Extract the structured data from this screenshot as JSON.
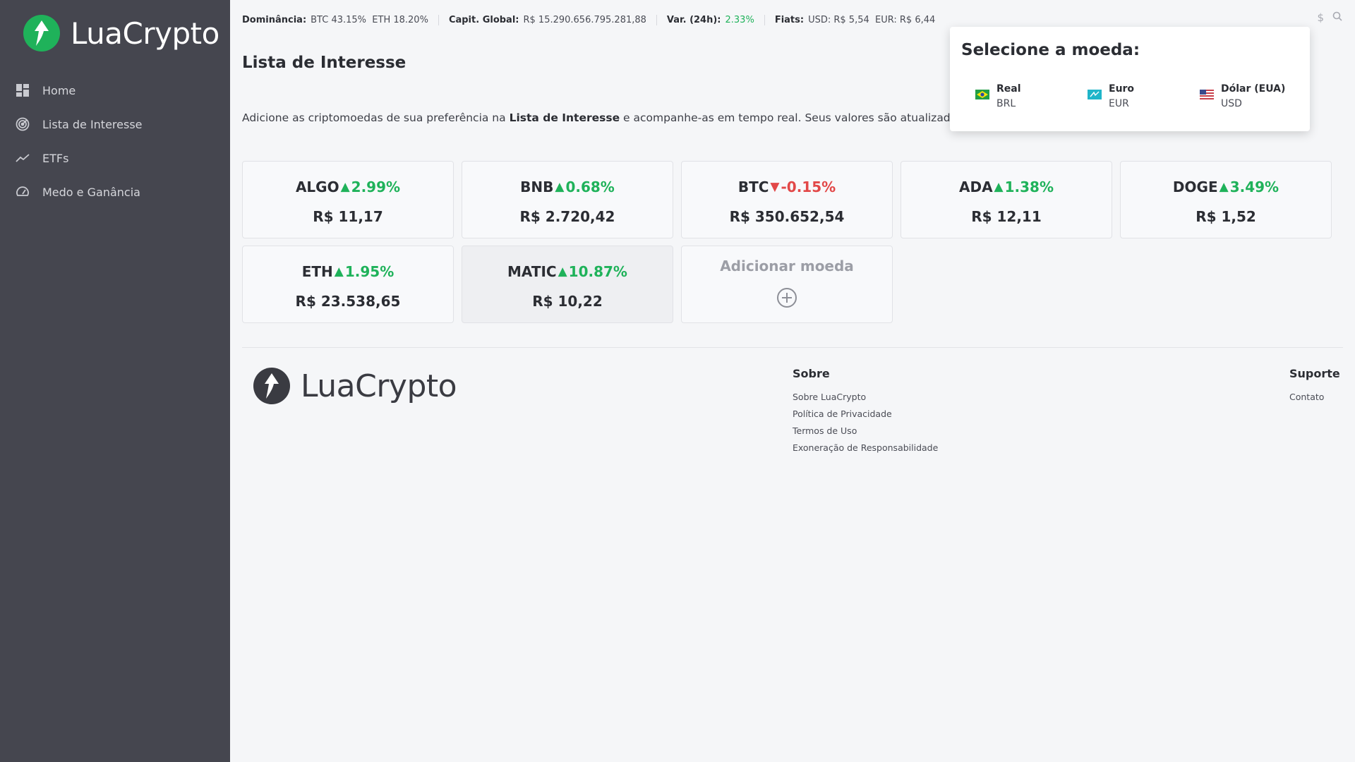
{
  "app": {
    "brand": "LuaCrypto"
  },
  "sidebar": {
    "items": [
      {
        "label": "Home",
        "icon": "dashboard-icon"
      },
      {
        "label": "Lista de Interesse",
        "icon": "radar-icon"
      },
      {
        "label": "ETFs",
        "icon": "trend-line-icon"
      },
      {
        "label": "Medo e Ganância",
        "icon": "gauge-icon"
      }
    ]
  },
  "topbar": {
    "dominance_label": "Dominância:",
    "dominance_btc": "BTC 43.15%",
    "dominance_eth": "ETH 18.20%",
    "cap_label": "Capit. Global:",
    "cap_value": "R$ 15.290.656.795.281,88",
    "var_label": "Var. (24h):",
    "var_value": "2.33%",
    "fiats_label": "Fiats:",
    "fiats_usd": "USD: R$ 5,54",
    "fiats_eur": "EUR: R$ 6,44",
    "icons": [
      "dollar-icon",
      "search-icon"
    ]
  },
  "main": {
    "title": "Lista de Interesse",
    "intro_before": "Adicione as criptomoedas de sua preferência na ",
    "intro_bold": "Lista de Interesse",
    "intro_after": " e acompanhe-as em tempo real. Seus valores são atualizados a cada"
  },
  "coins": [
    {
      "symbol": "ALGO",
      "change": "2.99%",
      "direction": "up",
      "price": "R$ 11,17"
    },
    {
      "symbol": "BNB",
      "change": "0.68%",
      "direction": "up",
      "price": "R$ 2.720,42"
    },
    {
      "symbol": "BTC",
      "change": "-0.15%",
      "direction": "down",
      "price": "R$ 350.652,54"
    },
    {
      "symbol": "ADA",
      "change": "1.38%",
      "direction": "up",
      "price": "R$ 12,11"
    },
    {
      "symbol": "DOGE",
      "change": "3.49%",
      "direction": "up",
      "price": "R$ 1,52"
    },
    {
      "symbol": "ETH",
      "change": "1.95%",
      "direction": "up",
      "price": "R$ 23.538,65"
    },
    {
      "symbol": "MATIC",
      "change": "10.87%",
      "direction": "up",
      "price": "R$ 10,22"
    }
  ],
  "add_card": {
    "label": "Adicionar moeda"
  },
  "footer": {
    "brand": "LuaCrypto",
    "about_title": "Sobre",
    "about_links": [
      "Sobre LuaCrypto",
      "Política de Privacidade",
      "Termos de Uso",
      "Exoneração de Responsabilidade"
    ],
    "support_title": "Suporte",
    "support_links": [
      "Contato"
    ]
  },
  "currency_popup": {
    "title": "Selecione a moeda:",
    "options": [
      {
        "name": "Real",
        "code": "BRL",
        "flag": "brazil-flag-icon"
      },
      {
        "name": "Euro",
        "code": "EUR",
        "flag": "eu-flag-icon"
      },
      {
        "name": "Dólar (EUA)",
        "code": "USD",
        "flag": "usa-flag-icon"
      }
    ]
  },
  "colors": {
    "sidebar": "#45464f",
    "up": "#1fb25a",
    "down": "#e24848",
    "background": "#f5f6f8"
  }
}
